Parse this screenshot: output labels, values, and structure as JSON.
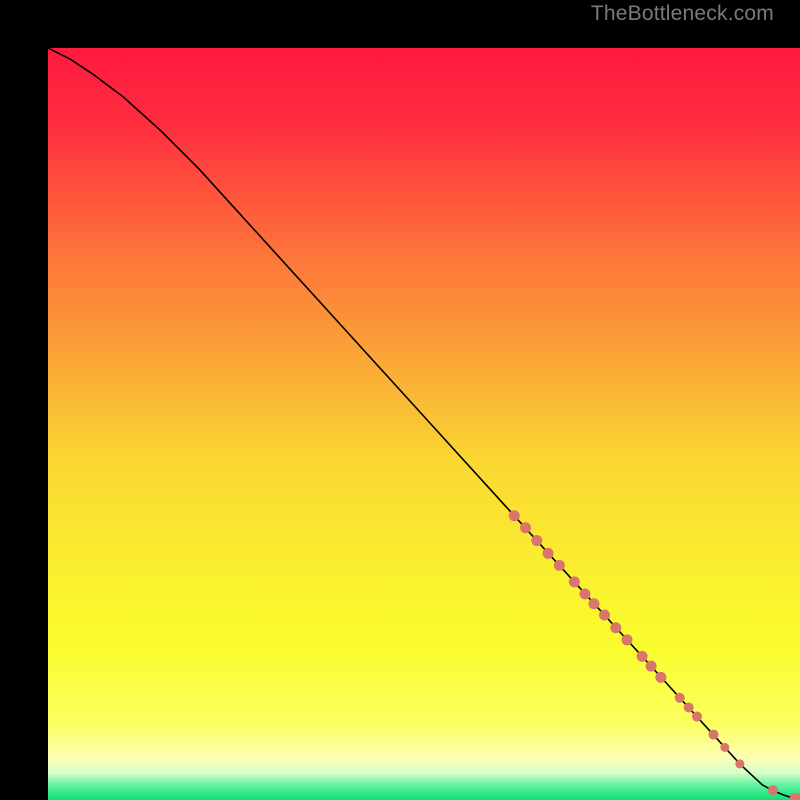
{
  "watermark": "TheBottleneck.com",
  "chart_data": {
    "type": "line",
    "title": "",
    "xlabel": "",
    "ylabel": "",
    "xlim": [
      0,
      100
    ],
    "ylim": [
      0,
      100
    ],
    "grid": false,
    "background_gradient": {
      "direction": "vertical",
      "stops": [
        {
          "offset": 0.0,
          "color": "#ff193f"
        },
        {
          "offset": 0.1,
          "color": "#ff2d3f"
        },
        {
          "offset": 0.25,
          "color": "#fd6b3b"
        },
        {
          "offset": 0.4,
          "color": "#fba137"
        },
        {
          "offset": 0.55,
          "color": "#fad732"
        },
        {
          "offset": 0.7,
          "color": "#faf02f"
        },
        {
          "offset": 0.8,
          "color": "#fafc2e"
        },
        {
          "offset": 0.9,
          "color": "#fbff61"
        },
        {
          "offset": 0.945,
          "color": "#fdffb8"
        },
        {
          "offset": 0.965,
          "color": "#d0ffc8"
        },
        {
          "offset": 0.98,
          "color": "#63f2a1"
        },
        {
          "offset": 0.995,
          "color": "#1fe47f"
        },
        {
          "offset": 1.0,
          "color": "#18db76"
        }
      ]
    },
    "series": [
      {
        "name": "curve",
        "color": "#000000",
        "x": [
          0,
          3,
          6,
          10,
          15,
          20,
          30,
          40,
          50,
          60,
          70,
          80,
          88,
          92,
          95,
          96.5,
          98,
          99,
          100,
          100
        ],
        "y": [
          100,
          98.5,
          96.5,
          93.5,
          89,
          84,
          73,
          62,
          51,
          40,
          29,
          18,
          9.2,
          4.8,
          2.0,
          1.2,
          0.6,
          0.3,
          0.15,
          0.15
        ]
      }
    ],
    "scatter": {
      "name": "points",
      "color": "#d9756a",
      "points": [
        {
          "x": 62.0,
          "y": 37.8,
          "r": 5.5
        },
        {
          "x": 63.5,
          "y": 36.2,
          "r": 5.5
        },
        {
          "x": 65.0,
          "y": 34.5,
          "r": 5.5
        },
        {
          "x": 66.5,
          "y": 32.8,
          "r": 5.5
        },
        {
          "x": 68.0,
          "y": 31.2,
          "r": 5.5
        },
        {
          "x": 70.0,
          "y": 29.0,
          "r": 5.5
        },
        {
          "x": 71.4,
          "y": 27.4,
          "r": 5.5
        },
        {
          "x": 72.6,
          "y": 26.1,
          "r": 5.5
        },
        {
          "x": 74.0,
          "y": 24.6,
          "r": 5.5
        },
        {
          "x": 75.5,
          "y": 22.9,
          "r": 5.5
        },
        {
          "x": 77.0,
          "y": 21.3,
          "r": 5.5
        },
        {
          "x": 79.0,
          "y": 19.1,
          "r": 5.5
        },
        {
          "x": 80.2,
          "y": 17.8,
          "r": 5.5
        },
        {
          "x": 81.5,
          "y": 16.3,
          "r": 5.5
        },
        {
          "x": 84.0,
          "y": 13.6,
          "r": 5.0
        },
        {
          "x": 85.2,
          "y": 12.3,
          "r": 5.0
        },
        {
          "x": 86.3,
          "y": 11.1,
          "r": 5.0
        },
        {
          "x": 88.5,
          "y": 8.7,
          "r": 5.0
        },
        {
          "x": 90.0,
          "y": 7.0,
          "r": 4.5
        },
        {
          "x": 92.0,
          "y": 4.8,
          "r": 4.5
        },
        {
          "x": 96.4,
          "y": 1.3,
          "r": 5.0
        },
        {
          "x": 99.3,
          "y": 0.25,
          "r": 5.0
        },
        {
          "x": 100.2,
          "y": 0.25,
          "r": 5.0
        }
      ]
    }
  }
}
